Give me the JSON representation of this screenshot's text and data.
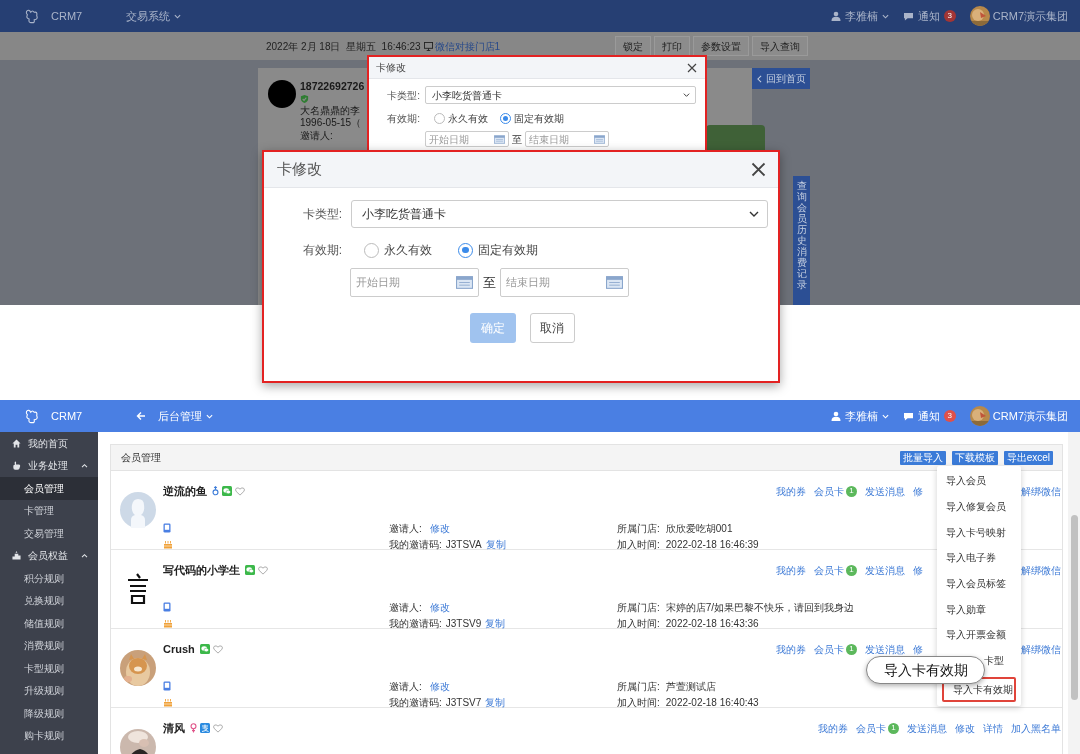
{
  "top_screen": {
    "navbar": {
      "brand": "CRM7",
      "menu": "交易系统",
      "user": "李雅楠",
      "notice": "通知",
      "notice_count": "3",
      "org": "CRM7演示集团"
    },
    "toolbar": {
      "datetime": "2022年 2月 18日  星期五  16:46:23",
      "store": "微信对接门店1",
      "buttons": [
        "锁定",
        "打印",
        "参数设置",
        "导入查询"
      ]
    },
    "member": {
      "phone": "18722692726",
      "lines": [
        "大名鼎鼎的李",
        "1996-05-15（",
        "邀请人:"
      ]
    },
    "back_button": "回到首页",
    "side_tab": "查询会员历史消费记录"
  },
  "dialog_small": {
    "title": "卡修改",
    "card_type_label": "卡类型:",
    "card_type": "小李吃货普通卡",
    "validity_label": "有效期:",
    "options": [
      {
        "label": "永久有效",
        "selected": false
      },
      {
        "label": "固定有效期",
        "selected": true
      }
    ],
    "start_placeholder": "开始日期",
    "to": "至",
    "end_placeholder": "结束日期"
  },
  "dialog": {
    "title": "卡修改",
    "card_type_label": "卡类型:",
    "card_type": "小李吃货普通卡",
    "validity_label": "有效期:",
    "options": [
      {
        "label": "永久有效",
        "selected": false
      },
      {
        "label": "固定有效期",
        "selected": true
      }
    ],
    "start_placeholder": "开始日期",
    "to": "至",
    "end_placeholder": "结束日期",
    "confirm": "确定",
    "cancel": "取消"
  },
  "bottom_screen": {
    "navbar": {
      "brand": "CRM7",
      "menu": "后台管理",
      "user": "李雅楠",
      "notice": "通知",
      "notice_count": "3",
      "org": "CRM7演示集团"
    },
    "sidebar": {
      "items": [
        {
          "label": "我的首页",
          "kind": "link"
        },
        {
          "label": "业务处理",
          "kind": "group",
          "expanded": true,
          "children": [
            {
              "label": "会员管理",
              "selected": true
            },
            {
              "label": "卡管理",
              "selected": false
            },
            {
              "label": "交易管理",
              "selected": false
            }
          ]
        },
        {
          "label": "会员权益",
          "kind": "group",
          "expanded": true,
          "children": [
            {
              "label": "积分规则",
              "selected": false
            },
            {
              "label": "兑换规则",
              "selected": false
            },
            {
              "label": "储值规则",
              "selected": false
            },
            {
              "label": "消费规则",
              "selected": false
            },
            {
              "label": "卡型规则",
              "selected": false
            },
            {
              "label": "升级规则",
              "selected": false
            },
            {
              "label": "降级规则",
              "selected": false
            },
            {
              "label": "购卡规则",
              "selected": false
            }
          ]
        }
      ]
    },
    "panel": {
      "title": "会员管理",
      "buttons": [
        "批量导入",
        "下载模板",
        "导出excel"
      ],
      "members": [
        {
          "name": "逆流的鱼",
          "avatar": {
            "kind": "default"
          },
          "badges": [
            {
              "kind": "male"
            },
            {
              "kind": "wechat"
            },
            {
              "kind": "heart"
            }
          ],
          "inviter_label": "邀请人:",
          "inviter_action": "修改",
          "code_label": "我的邀请码:",
          "code": "J3TSVA",
          "copy": "复制",
          "store_label": "所属门店:",
          "store": "欣欣爱吃胡001",
          "joined_label": "加入时间:",
          "joined": "2022-02-18 16:46:39",
          "actions": [
            {
              "label": "我的券"
            },
            {
              "label": "会员卡",
              "count": "1"
            },
            {
              "label": "发送消息"
            },
            {
              "label": "修"
            }
          ],
          "trailing_action": "解绑微信"
        },
        {
          "name": "写代码的小学生",
          "avatar": {
            "kind": "picture"
          },
          "badges": [
            {
              "kind": "wechat"
            },
            {
              "kind": "heart"
            }
          ],
          "inviter_label": "邀请人:",
          "inviter_action": "修改",
          "code_label": "我的邀请码:",
          "code": "J3TSV9",
          "copy": "复制",
          "store_label": "所属门店:",
          "store": "宋婷的店7/如果巴黎不快乐，请回到我身边",
          "joined_label": "加入时间:",
          "joined": "2022-02-18 16:43:36",
          "actions": [
            {
              "label": "我的券"
            },
            {
              "label": "会员卡",
              "count": "1"
            },
            {
              "label": "发送消息"
            },
            {
              "label": "修"
            }
          ],
          "trailing_action": "解绑微信"
        },
        {
          "name": "Crush",
          "avatar": {
            "kind": "picture"
          },
          "badges": [
            {
              "kind": "wechat"
            },
            {
              "kind": "heart"
            }
          ],
          "inviter_label": "邀请人:",
          "inviter_action": "修改",
          "code_label": "我的邀请码:",
          "code": "J3TSV7",
          "copy": "复制",
          "store_label": "所属门店:",
          "store": "芦萱测试店",
          "joined_label": "加入时间:",
          "joined": "2022-02-18 16:40:43",
          "actions": [
            {
              "label": "我的券"
            },
            {
              "label": "会员卡",
              "count": "1"
            },
            {
              "label": "发送消息"
            },
            {
              "label": "修"
            }
          ],
          "trailing_action": "解绑微信"
        },
        {
          "name": "清风",
          "avatar": {
            "kind": "picture"
          },
          "badges": [
            {
              "kind": "female"
            },
            {
              "kind": "alipay"
            },
            {
              "kind": "heart"
            }
          ],
          "actions": [
            {
              "label": "我的券"
            },
            {
              "label": "会员卡",
              "count": "1"
            },
            {
              "label": "发送消息"
            },
            {
              "label": "修改"
            },
            {
              "label": "详情"
            },
            {
              "label": "加入黑名单"
            }
          ]
        }
      ],
      "dropdown": [
        {
          "label": "导入会员",
          "selected": false
        },
        {
          "label": "导入修复会员",
          "selected": false
        },
        {
          "label": "导入卡号映射",
          "selected": false
        },
        {
          "label": "导入电子券",
          "selected": false
        },
        {
          "label": "导入会员标签",
          "selected": false
        },
        {
          "label": "导入勋章",
          "selected": false
        },
        {
          "label": "导入开票金额",
          "selected": false
        },
        {
          "label": "卡型",
          "selected": false,
          "covered": true
        },
        {
          "label": "导入卡有效期",
          "selected": true
        }
      ],
      "callout": "导入卡有效期"
    }
  }
}
